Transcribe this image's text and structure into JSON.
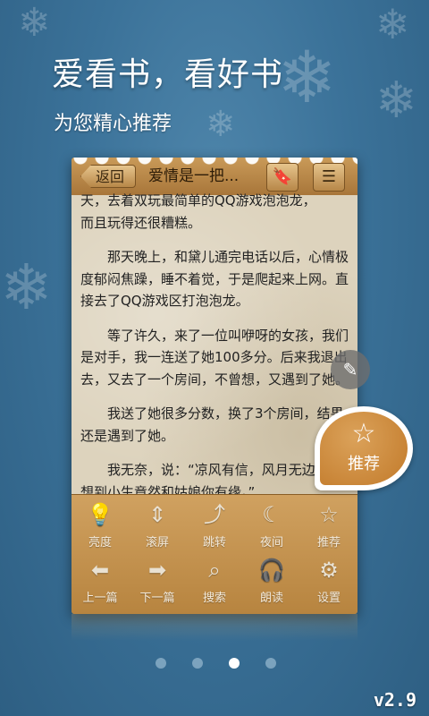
{
  "headline": "爱看书，看好书",
  "subline": "为您精心推荐",
  "reader": {
    "back_label": "返回",
    "book_title": "爱情是一把...",
    "bookmark_icon": "bookmark-icon",
    "menu_icon": "list-icon",
    "paragraphs": [
      {
        "text": "天，去着双玩最简单的QQ游戏泡泡龙，",
        "indent": false
      },
      {
        "text": "而且玩得还很糟糕。",
        "indent": false
      },
      {
        "text": "那天晚上，和黛儿通完电话以后，心情极度郁闷焦躁，睡不着觉，于是爬起来上网。直接去了QQ游戏区打泡泡龙。",
        "indent": true
      },
      {
        "text": "等了许久，来了一位叫咿呀的女孩，我们是对手，我一连送了她100多分。后来我退出去，又去了一个房间，不曾想，又遇到了她。",
        "indent": true
      },
      {
        "text": "我送了她很多分数，换了3个房间，结果还是遇到了她。",
        "indent": true
      },
      {
        "text": "我无奈，说：“凉风有信，风月无边，没想到小生竟然和姑娘你有缘。”",
        "indent": true
      }
    ]
  },
  "toolbar": {
    "row1": [
      {
        "label": "亮度",
        "icon": "bulb-icon"
      },
      {
        "label": "滚屏",
        "icon": "scroll-icon"
      },
      {
        "label": "跳转",
        "icon": "jump-icon"
      },
      {
        "label": "夜间",
        "icon": "moon-icon"
      },
      {
        "label": "推荐",
        "icon": "star-icon"
      }
    ],
    "row2": [
      {
        "label": "上一篇",
        "icon": "arrow-left-icon"
      },
      {
        "label": "下一篇",
        "icon": "arrow-right-icon"
      },
      {
        "label": "搜索",
        "icon": "search-icon"
      },
      {
        "label": "朗读",
        "icon": "headphones-icon"
      },
      {
        "label": "设置",
        "icon": "gear-icon"
      }
    ]
  },
  "recommend_bubble": {
    "label": "推荐",
    "icon": "star-icon"
  },
  "pager": {
    "count": 4,
    "active_index": 2
  },
  "version": "v2.9"
}
